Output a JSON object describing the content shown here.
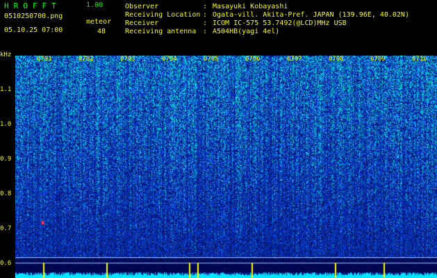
{
  "app": {
    "name": "HROFFT",
    "version": "1.00"
  },
  "file": {
    "name": "0510250700.png",
    "timestamp": "05.10.25 07:00"
  },
  "meteor": {
    "label": "meteor",
    "count": "48"
  },
  "info": [
    {
      "label": "Observer",
      "value": "Masayuki Kobayashi"
    },
    {
      "label": "Receiving Location",
      "value": "Ogata-vill. Akita-Pref. JAPAN (139.96E, 40.02N)"
    },
    {
      "label": "Receiver",
      "value": "ICOM IC-575 53.7492(@LCD)MHz USB"
    },
    {
      "label": "Receiving antenna",
      "value": "A504HB(yagi 4el)"
    }
  ],
  "separator": ":",
  "y_axis": {
    "unit": "kHz",
    "ticks": [
      "1.1",
      "1.0",
      "0.9",
      "0.8",
      "0.7",
      "0.6"
    ]
  },
  "x_axis": {
    "ticks": [
      "0701",
      "0702",
      "0703",
      "0704",
      "0705",
      "0706",
      "0707",
      "0708",
      "0709",
      "0710"
    ]
  },
  "colors": {
    "text": "#ffff00",
    "logo": "#00ff00",
    "background": "#000000",
    "noise_base": "#0b1f9a",
    "signal": "#00ffff"
  }
}
